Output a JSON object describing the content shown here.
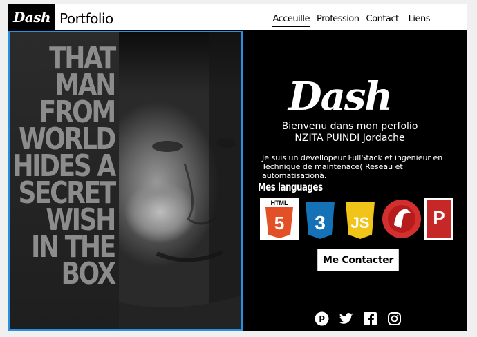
{
  "header": {
    "logo_text": "Dash",
    "brand": "Portfolio",
    "nav": [
      "Acceuille",
      "Profession",
      "Contact",
      "Liens"
    ]
  },
  "poster": {
    "lines": [
      "THAT",
      "MAN",
      "FROM",
      "WORLD",
      "HIDES A",
      "SECRET",
      "WISH",
      "IN THE",
      "BOX"
    ]
  },
  "hero": {
    "logo_text": "Dash",
    "welcome_line1": "Bienvenu dans mon perfolio",
    "welcome_line2": "NZITA PUINDI Jordache",
    "bio": "Je suis un devellopeur FullStack et ingenieur en Technique de maintenace( Reseau et automatisationà.",
    "languages_title": "Mes languages",
    "languages": [
      {
        "name": "HTML",
        "color": "#e34f26",
        "icon": "html5-icon"
      },
      {
        "name": "CSS3",
        "color": "#1572b6",
        "icon": "css3-icon"
      },
      {
        "name": "JS",
        "color": "#f0c419",
        "icon": "js-icon"
      },
      {
        "name": "Laravel",
        "color": "#d32f2f",
        "icon": "laravel-icon"
      },
      {
        "name": "P",
        "color": "#c62828",
        "icon": "php-book-icon"
      }
    ],
    "contact_button": "Me Contacter"
  },
  "social": [
    "pinterest-icon",
    "twitter-icon",
    "facebook-icon",
    "instagram-icon"
  ]
}
